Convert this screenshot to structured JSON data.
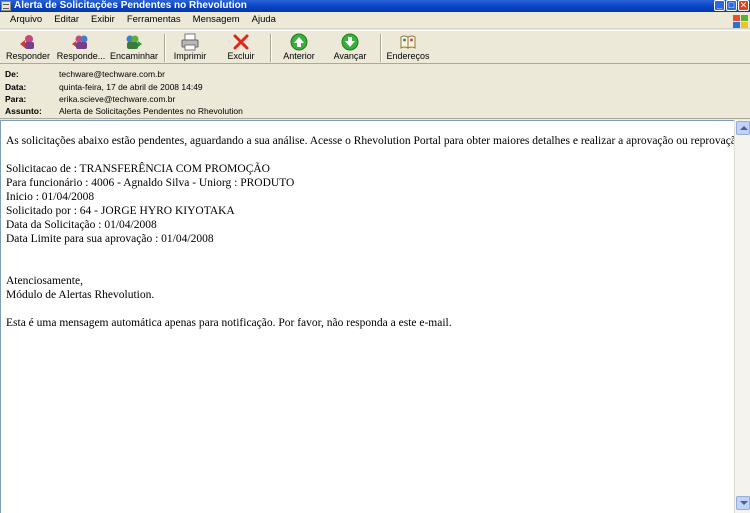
{
  "window": {
    "title": "Alerta de Solicitações Pendentes no Rhevolution"
  },
  "menu": {
    "items": [
      "Arquivo",
      "Editar",
      "Exibir",
      "Ferramentas",
      "Mensagem",
      "Ajuda"
    ]
  },
  "toolbar": {
    "reply": "Responder",
    "reply_all": "Responde...",
    "forward": "Encaminhar",
    "print": "Imprimir",
    "delete": "Excluir",
    "previous": "Anterior",
    "next": "Avançar",
    "addresses": "Endereços"
  },
  "headers": {
    "from_label": "De:",
    "from_value": "techware@techware.com.br",
    "date_label": "Data:",
    "date_value": "quinta-feira, 17 de abril de 2008 14:49",
    "to_label": "Para:",
    "to_value": "erika.scieve@techware.com.br",
    "subject_label": "Assunto:",
    "subject_value": "Alerta de Solicitações Pendentes no Rhevolution"
  },
  "body": {
    "intro": "As solicitações abaixo estão pendentes, aguardando a sua análise. Acesse o Rhevolution Portal para obter maiores detalhes e realizar a aprovação ou reprovação.",
    "request_type": "Solicitacao de : TRANSFERÊNCIA COM PROMOÇÃO",
    "employee": "Para funcionário : 4006 - Agnaldo Silva - Uniorg : PRODUTO",
    "start": "Inicio : 01/04/2008",
    "requested_by": "Solicitado por : 64 - JORGE HYRO KIYOTAKA",
    "request_date": "Data da Solicitação : 01/04/2008",
    "deadline": "Data Limite para sua aprovação : 01/04/2008",
    "closing": "Atenciosamente,",
    "signature": "Módulo de Alertas Rhevolution.",
    "notice": "Esta é uma mensagem automática apenas para notificação. Por favor, não responda a este e-mail."
  },
  "colors": {
    "titlebar": "#0a46c8",
    "chrome": "#ece9d8",
    "close_button": "#d9421c"
  }
}
